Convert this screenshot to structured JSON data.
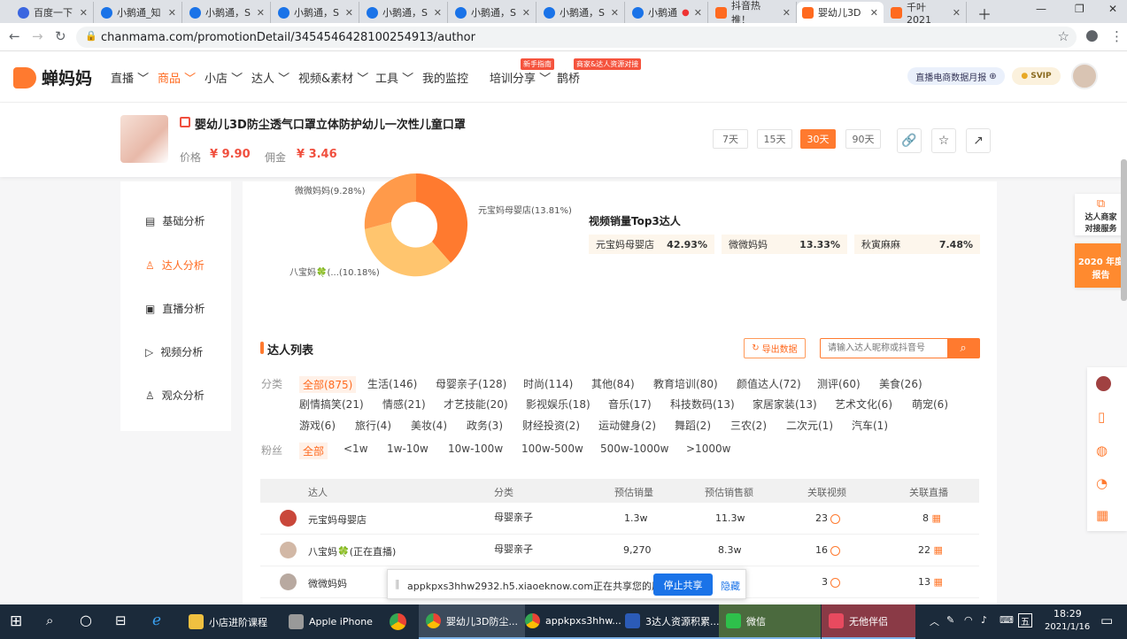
{
  "browser": {
    "tabs": [
      {
        "label": "百度一下",
        "icon": "baidu-paw-icon"
      },
      {
        "label": "小鹅通_知",
        "icon": "chrome-page-icon"
      },
      {
        "label": "小鹅通，S",
        "icon": "chrome-page-icon"
      },
      {
        "label": "小鹅通，S",
        "icon": "chrome-page-icon"
      },
      {
        "label": "小鹅通，S",
        "icon": "chrome-page-icon"
      },
      {
        "label": "小鹅通，S",
        "icon": "chrome-page-icon"
      },
      {
        "label": "小鹅通，S",
        "icon": "chrome-page-icon"
      },
      {
        "label": "小鹅通",
        "icon": "chrome-page-icon"
      },
      {
        "label": "抖音热推！",
        "icon": "chanmama-icon"
      },
      {
        "label": "婴幼儿3D",
        "icon": "chanmama-icon"
      },
      {
        "label": "千叶 2021",
        "icon": "chanmama-icon"
      }
    ],
    "url": "chanmama.com/promotionDetail/3454546428100254913/author"
  },
  "site": {
    "brand": "蝉妈妈",
    "nav": [
      "直播",
      "商品",
      "小店",
      "达人",
      "视频&素材",
      "工具",
      "我的监控",
      "培训分享",
      "鹊桥"
    ],
    "nav_badges": [
      "新手指南",
      "商家&达人资源对接"
    ],
    "report_btn": "直播电商数据月报",
    "vip": "SVIP"
  },
  "product": {
    "title": "婴幼儿3D防尘透气口罩立体防护幼儿一次性儿童口罩",
    "price_label": "价格",
    "price": "¥ 9.90",
    "commission_label": "佣金",
    "commission": "¥ 3.46",
    "ranges": [
      "7天",
      "15天",
      "30天",
      "90天"
    ],
    "active_range": "30天"
  },
  "sidebar": [
    "基础分析",
    "达人分析",
    "直播分析",
    "视频分析",
    "观众分析"
  ],
  "donut": {
    "labels": [
      "元宝妈母婴店(13.81%)",
      "微微妈妈(9.28%)",
      "八宝妈🍀(...(10.18%)"
    ],
    "colors": [
      "#ff7a2f",
      "#ffad55",
      "#ffc56e"
    ]
  },
  "top3": {
    "title": "视频销量Top3达人",
    "items": [
      {
        "name": "元宝妈母婴店",
        "val": "42.93%"
      },
      {
        "name": "微微妈妈",
        "val": "13.33%"
      },
      {
        "name": "秋寅麻麻",
        "val": "7.48%"
      }
    ]
  },
  "list": {
    "title": "达人列表",
    "export": "导出数据",
    "search_placeholder": "请输入达人昵称或抖音号",
    "cat_label": "分类",
    "cats": [
      "全部(875)",
      "生活(146)",
      "母婴亲子(128)",
      "时尚(114)",
      "其他(84)",
      "教育培训(80)",
      "颜值达人(72)",
      "测评(60)",
      "美食(26)",
      "剧情搞笑(21)",
      "情感(21)",
      "才艺技能(20)",
      "影视娱乐(18)",
      "音乐(17)",
      "科技数码(13)",
      "家居家装(13)",
      "艺术文化(6)",
      "萌宠(6)",
      "游戏(6)",
      "旅行(4)",
      "美妆(4)",
      "政务(3)",
      "财经投资(2)",
      "运动健身(2)",
      "舞蹈(2)",
      "三农(2)",
      "二次元(1)",
      "汽车(1)"
    ],
    "fans_label": "粉丝",
    "fans": [
      "全部",
      "<1w",
      "1w-10w",
      "10w-100w",
      "100w-500w",
      "500w-1000w",
      ">1000w"
    ],
    "columns": [
      "达人",
      "分类",
      "预估销量",
      "预估销售额",
      "关联视频",
      "关联直播"
    ],
    "rows": [
      {
        "name": "元宝妈母婴店",
        "cat": "母婴亲子",
        "sales": "1.3w",
        "amount": "11.3w",
        "videos": "23",
        "lives": "8"
      },
      {
        "name": "八宝妈🍀(正在直播)",
        "cat": "母婴亲子",
        "sales": "9,270",
        "amount": "8.3w",
        "videos": "16",
        "lives": "22"
      },
      {
        "name": "微微妈妈",
        "cat": "",
        "sales": "",
        "amount": "",
        "videos": "3",
        "lives": "13"
      }
    ]
  },
  "share_bar": {
    "text": "appkpxs3hhw2932.h5.xiaoeknow.com正在共享您的屏幕。",
    "stop": "停止共享",
    "hide": "隐藏"
  },
  "right_float": {
    "service": "达人商家对接服务",
    "report": "2020 年度报告"
  },
  "taskbar": {
    "items": [
      "小店进阶课程",
      "Apple iPhone",
      "婴幼儿3D防尘...",
      "appkpxs3hhw...",
      "3达人资源积累...",
      "微信",
      "无他伴侣"
    ],
    "time": "18:29",
    "date": "2021/1/16"
  }
}
